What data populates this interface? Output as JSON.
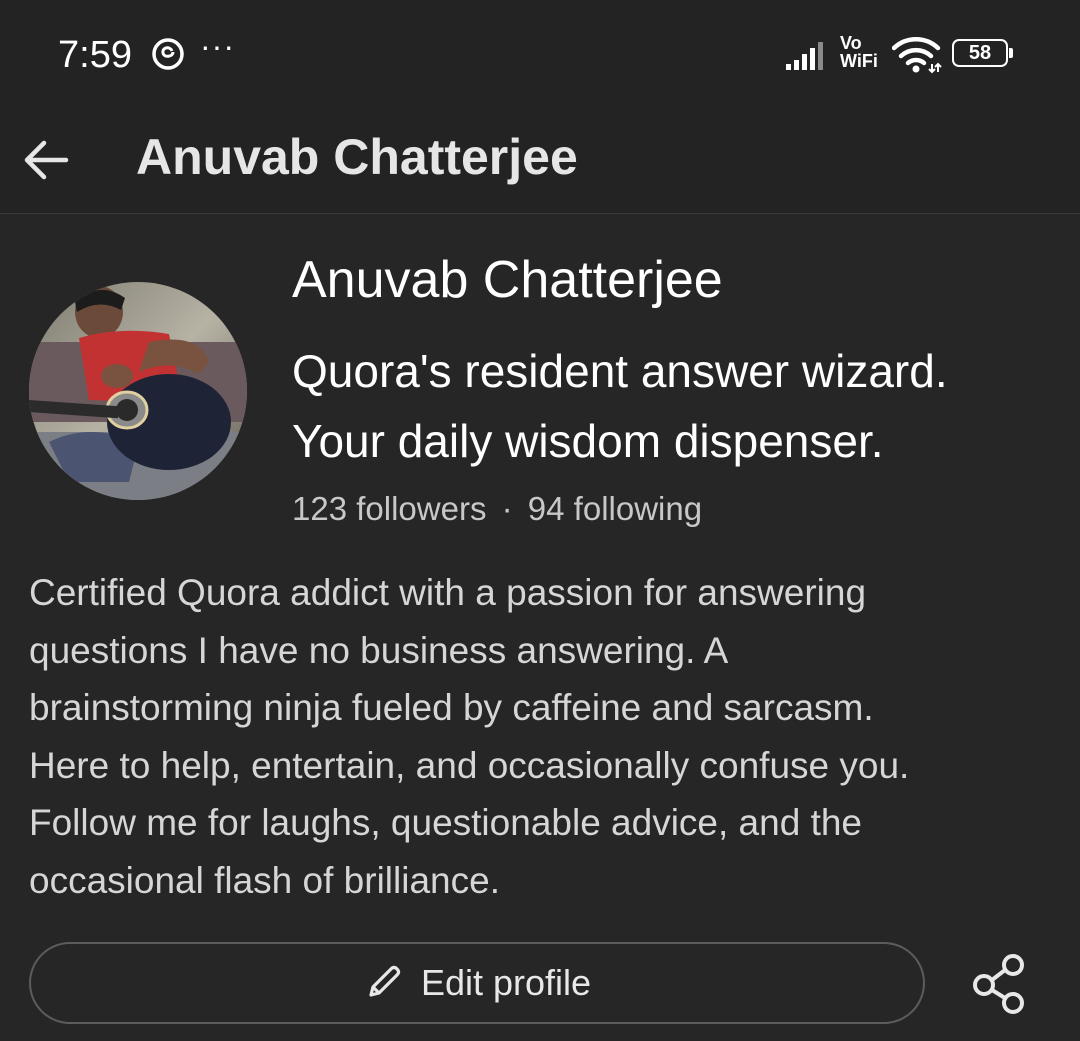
{
  "status_bar": {
    "time": "7:59",
    "more": "···",
    "network_label_top": "Vo",
    "network_label_bottom": "WiFi",
    "battery_level": "58",
    "icons": [
      "threads-icon",
      "signal-icon",
      "wifi-icon",
      "battery-icon"
    ]
  },
  "header": {
    "back_icon": "arrow-left-icon",
    "title": "Anuvab Chatterjee"
  },
  "profile": {
    "name": "Anuvab Chatterjee",
    "tagline_lines": [
      "Quora's resident answer wizard.",
      "Your daily wisdom dispenser."
    ],
    "followers": "123 followers",
    "separator": "·",
    "following": "94 following",
    "bio_lines": [
      "Certified Quora addict with a passion for answering",
      "questions I have no business answering. A",
      "brainstorming ninja fueled by caffeine and sarcasm.",
      "Here to help, entertain, and occasionally confuse you.",
      "Follow me for laughs, questionable advice, and the",
      "occasional flash of brilliance."
    ]
  },
  "actions": {
    "edit_label": "Edit profile",
    "edit_icon": "pencil-icon",
    "share_icon": "share-icon"
  }
}
